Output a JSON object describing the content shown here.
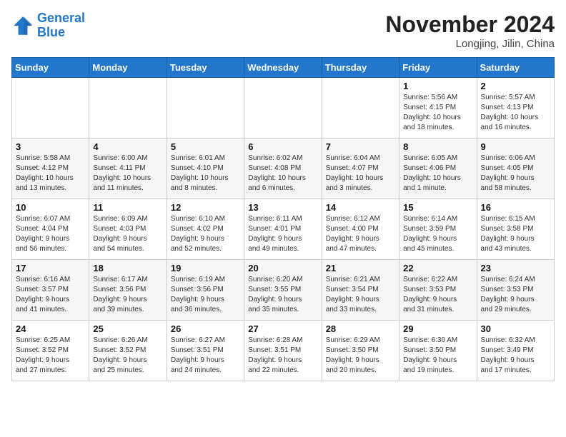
{
  "header": {
    "logo_line1": "General",
    "logo_line2": "Blue",
    "month": "November 2024",
    "location": "Longjing, Jilin, China"
  },
  "weekdays": [
    "Sunday",
    "Monday",
    "Tuesday",
    "Wednesday",
    "Thursday",
    "Friday",
    "Saturday"
  ],
  "weeks": [
    [
      {
        "day": "",
        "info": ""
      },
      {
        "day": "",
        "info": ""
      },
      {
        "day": "",
        "info": ""
      },
      {
        "day": "",
        "info": ""
      },
      {
        "day": "",
        "info": ""
      },
      {
        "day": "1",
        "info": "Sunrise: 5:56 AM\nSunset: 4:15 PM\nDaylight: 10 hours\nand 18 minutes."
      },
      {
        "day": "2",
        "info": "Sunrise: 5:57 AM\nSunset: 4:13 PM\nDaylight: 10 hours\nand 16 minutes."
      }
    ],
    [
      {
        "day": "3",
        "info": "Sunrise: 5:58 AM\nSunset: 4:12 PM\nDaylight: 10 hours\nand 13 minutes."
      },
      {
        "day": "4",
        "info": "Sunrise: 6:00 AM\nSunset: 4:11 PM\nDaylight: 10 hours\nand 11 minutes."
      },
      {
        "day": "5",
        "info": "Sunrise: 6:01 AM\nSunset: 4:10 PM\nDaylight: 10 hours\nand 8 minutes."
      },
      {
        "day": "6",
        "info": "Sunrise: 6:02 AM\nSunset: 4:08 PM\nDaylight: 10 hours\nand 6 minutes."
      },
      {
        "day": "7",
        "info": "Sunrise: 6:04 AM\nSunset: 4:07 PM\nDaylight: 10 hours\nand 3 minutes."
      },
      {
        "day": "8",
        "info": "Sunrise: 6:05 AM\nSunset: 4:06 PM\nDaylight: 10 hours\nand 1 minute."
      },
      {
        "day": "9",
        "info": "Sunrise: 6:06 AM\nSunset: 4:05 PM\nDaylight: 9 hours\nand 58 minutes."
      }
    ],
    [
      {
        "day": "10",
        "info": "Sunrise: 6:07 AM\nSunset: 4:04 PM\nDaylight: 9 hours\nand 56 minutes."
      },
      {
        "day": "11",
        "info": "Sunrise: 6:09 AM\nSunset: 4:03 PM\nDaylight: 9 hours\nand 54 minutes."
      },
      {
        "day": "12",
        "info": "Sunrise: 6:10 AM\nSunset: 4:02 PM\nDaylight: 9 hours\nand 52 minutes."
      },
      {
        "day": "13",
        "info": "Sunrise: 6:11 AM\nSunset: 4:01 PM\nDaylight: 9 hours\nand 49 minutes."
      },
      {
        "day": "14",
        "info": "Sunrise: 6:12 AM\nSunset: 4:00 PM\nDaylight: 9 hours\nand 47 minutes."
      },
      {
        "day": "15",
        "info": "Sunrise: 6:14 AM\nSunset: 3:59 PM\nDaylight: 9 hours\nand 45 minutes."
      },
      {
        "day": "16",
        "info": "Sunrise: 6:15 AM\nSunset: 3:58 PM\nDaylight: 9 hours\nand 43 minutes."
      }
    ],
    [
      {
        "day": "17",
        "info": "Sunrise: 6:16 AM\nSunset: 3:57 PM\nDaylight: 9 hours\nand 41 minutes."
      },
      {
        "day": "18",
        "info": "Sunrise: 6:17 AM\nSunset: 3:56 PM\nDaylight: 9 hours\nand 39 minutes."
      },
      {
        "day": "19",
        "info": "Sunrise: 6:19 AM\nSunset: 3:56 PM\nDaylight: 9 hours\nand 36 minutes."
      },
      {
        "day": "20",
        "info": "Sunrise: 6:20 AM\nSunset: 3:55 PM\nDaylight: 9 hours\nand 35 minutes."
      },
      {
        "day": "21",
        "info": "Sunrise: 6:21 AM\nSunset: 3:54 PM\nDaylight: 9 hours\nand 33 minutes."
      },
      {
        "day": "22",
        "info": "Sunrise: 6:22 AM\nSunset: 3:53 PM\nDaylight: 9 hours\nand 31 minutes."
      },
      {
        "day": "23",
        "info": "Sunrise: 6:24 AM\nSunset: 3:53 PM\nDaylight: 9 hours\nand 29 minutes."
      }
    ],
    [
      {
        "day": "24",
        "info": "Sunrise: 6:25 AM\nSunset: 3:52 PM\nDaylight: 9 hours\nand 27 minutes."
      },
      {
        "day": "25",
        "info": "Sunrise: 6:26 AM\nSunset: 3:52 PM\nDaylight: 9 hours\nand 25 minutes."
      },
      {
        "day": "26",
        "info": "Sunrise: 6:27 AM\nSunset: 3:51 PM\nDaylight: 9 hours\nand 24 minutes."
      },
      {
        "day": "27",
        "info": "Sunrise: 6:28 AM\nSunset: 3:51 PM\nDaylight: 9 hours\nand 22 minutes."
      },
      {
        "day": "28",
        "info": "Sunrise: 6:29 AM\nSunset: 3:50 PM\nDaylight: 9 hours\nand 20 minutes."
      },
      {
        "day": "29",
        "info": "Sunrise: 6:30 AM\nSunset: 3:50 PM\nDaylight: 9 hours\nand 19 minutes."
      },
      {
        "day": "30",
        "info": "Sunrise: 6:32 AM\nSunset: 3:49 PM\nDaylight: 9 hours\nand 17 minutes."
      }
    ]
  ]
}
